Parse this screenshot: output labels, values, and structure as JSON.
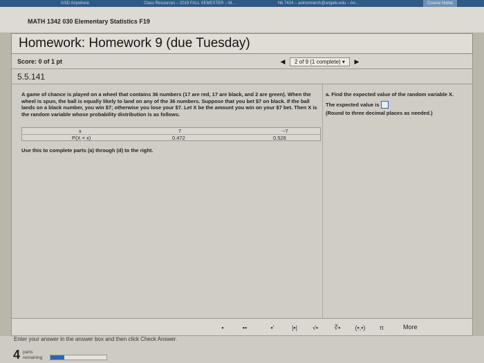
{
  "browser": {
    "tabs": [
      "GSD Anywhere",
      "Class Resources – 2019 FALL SEMESTER – M...",
      "Nk 7424 – astronmerch@angelo.edu – An...",
      "Course Home"
    ]
  },
  "course": {
    "title": "MATH 1342 030 Elementary Statistics F19"
  },
  "homework": {
    "title": "Homework: Homework 9 (due Tuesday)",
    "score": "Score: 0 of 1 pt",
    "question_selector": "2 of 9 (1 complete) ▾",
    "question_number": "5.5.141"
  },
  "problem": {
    "text": "A game of chance is played on a wheel that contains 36 numbers (17 are red, 17 are black, and 2 are green). When the wheel is spun, the ball is equally likely to land on any of the 36 numbers. Suppose that you bet $7 on black. If the ball lands on a black number, you win $7; otherwise you lose your $7. Let X be the amount you win on your $7 bet. Then X is the random variable whose probability distribution is as follows.",
    "table": {
      "x_label": "x",
      "p_label": "P(X = x)",
      "x_values": [
        "7",
        "−7"
      ],
      "p_values": [
        "0.472",
        "0.528"
      ]
    },
    "use_text": "Use this to complete parts (a) through (d) to the right."
  },
  "part_a": {
    "prompt": "a. Find the expected value of the random variable X.",
    "answer_label": "The expected value is",
    "answer_value": "",
    "note": "(Round to three decimal places as needed.)"
  },
  "toolbar": {
    "tools": [
      {
        "icon": "fraction-icon",
        "glyph": "▪"
      },
      {
        "icon": "mixed-number-icon",
        "glyph": "▪▪"
      },
      {
        "icon": "exponent-icon",
        "glyph": "▪'"
      },
      {
        "icon": "absolute-value-icon",
        "glyph": "|▪|"
      },
      {
        "icon": "square-root-icon",
        "glyph": "√▪"
      },
      {
        "icon": "nth-root-icon",
        "glyph": "∛▪"
      },
      {
        "icon": "ordered-pair-icon",
        "glyph": "(▪,▪)"
      },
      {
        "icon": "pi-icon",
        "glyph": "π"
      }
    ],
    "more_label": "More"
  },
  "footer": {
    "instruction": "Enter your answer in the answer box and then click Check Answer.",
    "parts_remaining": "4",
    "parts_label_1": "parts",
    "parts_label_2": "remaining",
    "progress_fraction": 0.25
  },
  "colors": {
    "accent": "#2b66b3",
    "topbar": "#2f5a86"
  }
}
